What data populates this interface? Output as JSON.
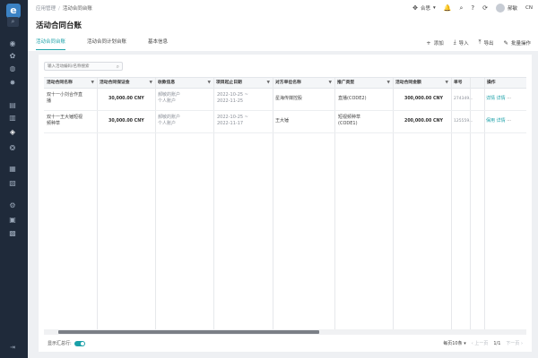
{
  "sidebar": {
    "logo": "e",
    "search_icon": "⌕",
    "icons": [
      {
        "name": "dashboard-icon",
        "glyph": "◉",
        "active": false
      },
      {
        "name": "gear-icon",
        "glyph": "✿",
        "active": false
      },
      {
        "name": "grid-icon",
        "glyph": "◍",
        "active": false
      },
      {
        "name": "star-icon",
        "glyph": "✸",
        "active": false
      },
      {
        "name": "document-icon",
        "glyph": "▤",
        "active": false
      },
      {
        "name": "folder-icon",
        "glyph": "▥",
        "active": false
      },
      {
        "name": "contract-icon",
        "glyph": "◈",
        "active": true
      },
      {
        "name": "settings-icon",
        "glyph": "❂",
        "active": false
      },
      {
        "name": "calendar-icon",
        "glyph": "▦",
        "active": false
      },
      {
        "name": "chart-icon",
        "glyph": "▧",
        "active": false
      },
      {
        "name": "link-icon",
        "glyph": "⚙",
        "active": false
      },
      {
        "name": "users-icon",
        "glyph": "▣",
        "active": false
      },
      {
        "name": "archive-icon",
        "glyph": "▩",
        "active": false
      }
    ],
    "bottom_icon": "⇥"
  },
  "header": {
    "breadcrumb": [
      "应用管理",
      "活动合同台账"
    ],
    "title": "活动合同台账",
    "top_right": {
      "org_label": "合思",
      "bell_icon": "🔔",
      "search_icon": "⌕",
      "help_icon": "?",
      "refresh_icon": "⟳",
      "user_name": "郝敏",
      "lang": "CN"
    },
    "tabs": [
      {
        "label": "活动合同台账",
        "active": true
      },
      {
        "label": "活动合同计划台账",
        "active": false
      },
      {
        "label": "基本信息",
        "active": false
      }
    ],
    "actions": [
      {
        "glyph": "+",
        "label": "添加"
      },
      {
        "glyph": "⤓",
        "label": "导入"
      },
      {
        "glyph": "⤒",
        "label": "导出"
      },
      {
        "glyph": "✎",
        "label": "批量操作"
      }
    ]
  },
  "search": {
    "placeholder": "输入活动编码/名称搜索",
    "icon": "⌕"
  },
  "table": {
    "columns": [
      {
        "label": "活动合同名称",
        "filter": true
      },
      {
        "label": "活动合同保证金",
        "filter": true
      },
      {
        "label": "收款信息",
        "filter": true
      },
      {
        "label": "项目起止日期",
        "filter": true
      },
      {
        "label": "对方单位名称",
        "filter": true
      },
      {
        "label": "推广类型",
        "filter": true
      },
      {
        "label": "活动合同金额",
        "filter": true
      },
      {
        "label": "单号",
        "filter": false
      },
      {
        "label": "操作",
        "filter": false
      }
    ],
    "filter_glyph": "▼",
    "rows": [
      {
        "name_line1": "双十一小刘合作直",
        "name_line2": "播",
        "deposit": "30,000.00 CNY",
        "payee_line1": "郝敏的账户",
        "payee_line2": "个人账户",
        "date_line1": "2022-10-25 ~",
        "date_line2": "2022-11-25",
        "company": "星海传媒控股",
        "promo_line1": "直播(CODE2)",
        "promo_line2": "",
        "amount": "300,000.00 CNY",
        "order_no": "274349...",
        "op_view": "详情",
        "op_edit": "详情",
        "op_more": "···"
      },
      {
        "name_line1": "双十一王大锤短视",
        "name_line2": "频种草",
        "deposit": "30,000.00 CNY",
        "payee_line1": "郝敏的账户",
        "payee_line2": "个人账户",
        "date_line1": "2022-10-25 ~",
        "date_line2": "2022-11-17",
        "company": "王大锤",
        "promo_line1": "短视频种草",
        "promo_line2": "(CODE1)",
        "amount": "200,000.00 CNY",
        "order_no": "125559...",
        "op_view": "保用",
        "op_edit": "详情",
        "op_more": "···"
      }
    ]
  },
  "footer": {
    "toggle_label": "显示汇总行:",
    "toggle_on": true,
    "page_size": "每页10条",
    "prev": "上一页",
    "page_info": "1/1",
    "next": "下一页"
  },
  "colors": {
    "accent": "#1aa0a8",
    "sidebar": "#1f2a3a"
  }
}
